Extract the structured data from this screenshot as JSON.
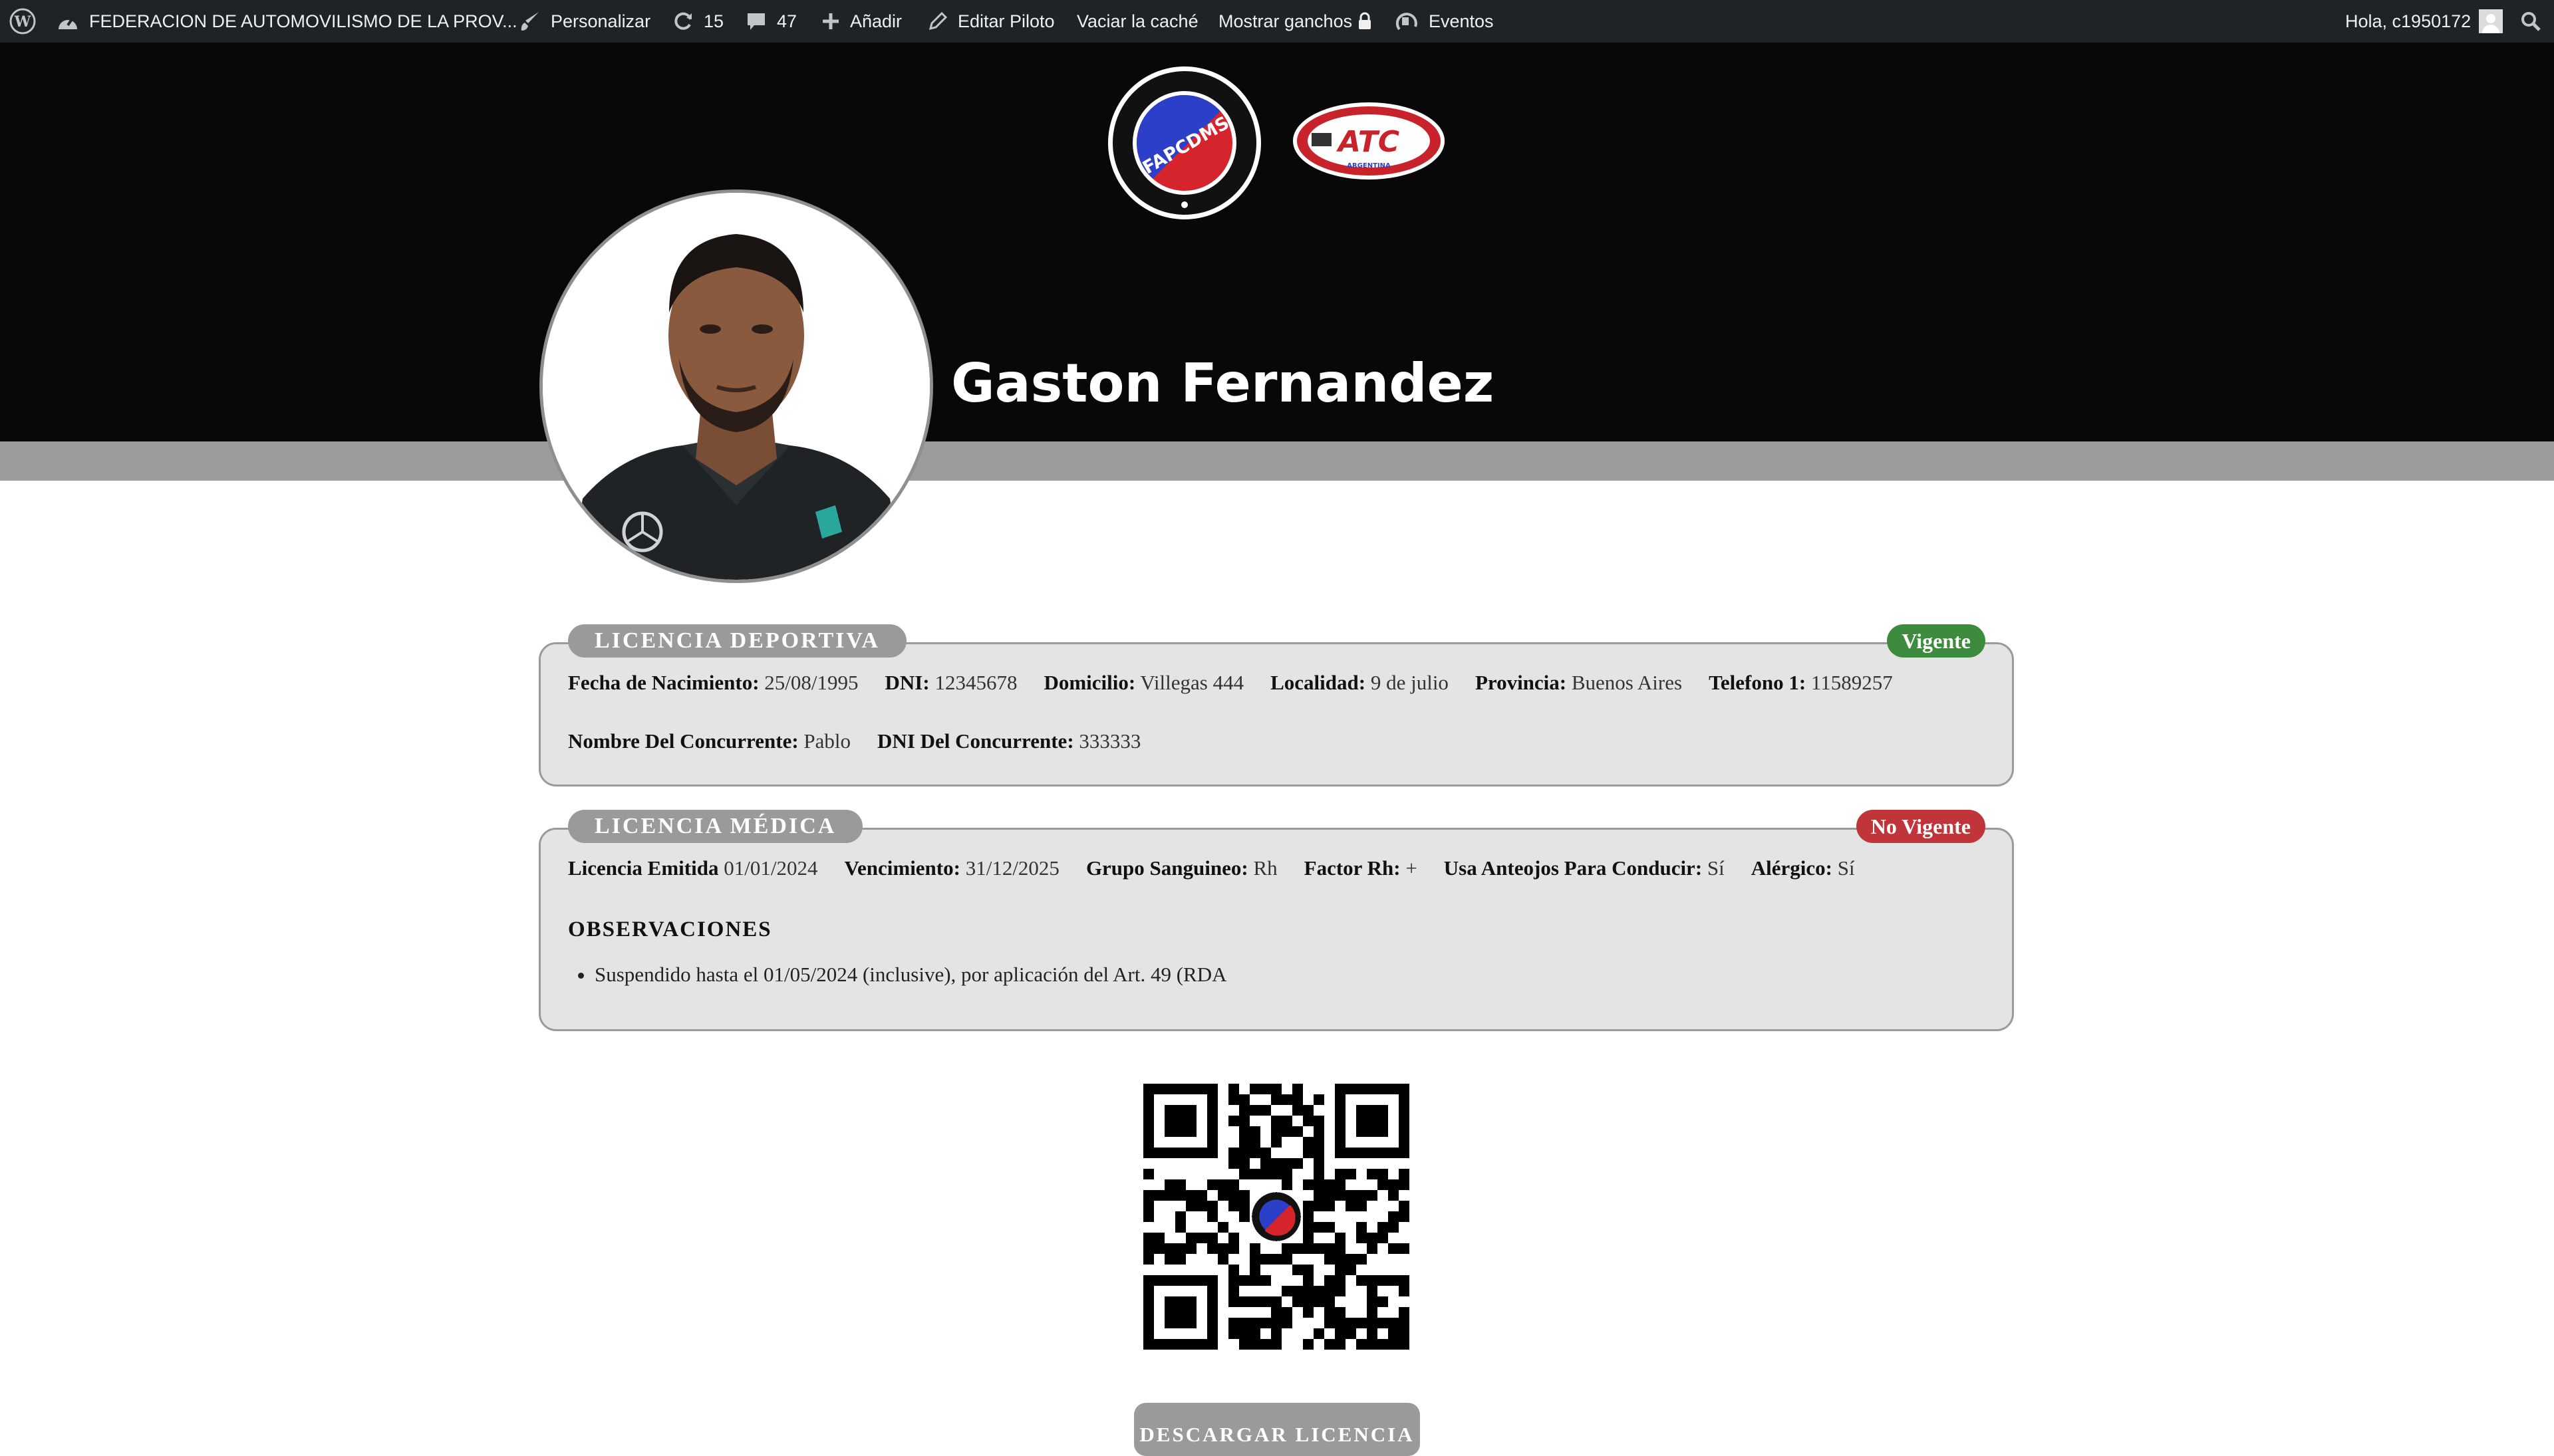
{
  "admin_bar": {
    "site_name": "FEDERACION DE AUTOMOVILISMO DE LA PROV...",
    "customize": "Personalizar",
    "updates_count": "15",
    "comments_count": "47",
    "add_new": "Añadir",
    "edit_pilot": "Editar Piloto",
    "clear_cache": "Vaciar la caché",
    "show_hooks": "Mostrar ganchos",
    "events": "Eventos",
    "greeting": "Hola, c1950172"
  },
  "header": {
    "logo_fap_text": "FAPCDMS",
    "logo_atc_text": "ATC",
    "logo_atc_sub": "ARGENTINA",
    "pilot_name": "Gaston Fernandez"
  },
  "licencia_deportiva": {
    "title": "LICENCIA DEPORTIVA",
    "status": "Vigente",
    "fields": [
      {
        "label": "Fecha de Nacimiento:",
        "value": "25/08/1995"
      },
      {
        "label": "DNI:",
        "value": "12345678"
      },
      {
        "label": "Domicilio:",
        "value": "Villegas 444"
      },
      {
        "label": "Localidad:",
        "value": "9 de julio"
      },
      {
        "label": "Provincia:",
        "value": "Buenos Aires"
      },
      {
        "label": "Telefono 1:",
        "value": "11589257"
      },
      {
        "label": "Nombre Del Concurrente:",
        "value": "Pablo"
      },
      {
        "label": "DNI Del Concurrente:",
        "value": "333333"
      }
    ]
  },
  "licencia_medica": {
    "title": "LICENCIA MÉDICA",
    "status": "No Vigente",
    "fields": [
      {
        "label": "Licencia Emitida",
        "value": "01/01/2024"
      },
      {
        "label": "Vencimiento:",
        "value": "31/12/2025"
      },
      {
        "label": "Grupo Sanguineo:",
        "value": "Rh"
      },
      {
        "label": "Factor Rh:",
        "value": "+"
      },
      {
        "label": "Usa Anteojos Para Conducir:",
        "value": "Sí"
      },
      {
        "label": "Alérgico:",
        "value": "Sí"
      }
    ],
    "observaciones_title": "OBSERVACIONES",
    "observaciones": [
      "Suspendido hasta el 01/05/2024 (inclusive), por aplicación del Art. 49 (RDA"
    ]
  },
  "download_button": "DESCARGAR LICENCIA",
  "colors": {
    "vigente": "#3d8b3d",
    "no_vigente": "#c0353a",
    "card_bg": "#e4e4e4",
    "tab_bg": "#9a9a9a"
  }
}
